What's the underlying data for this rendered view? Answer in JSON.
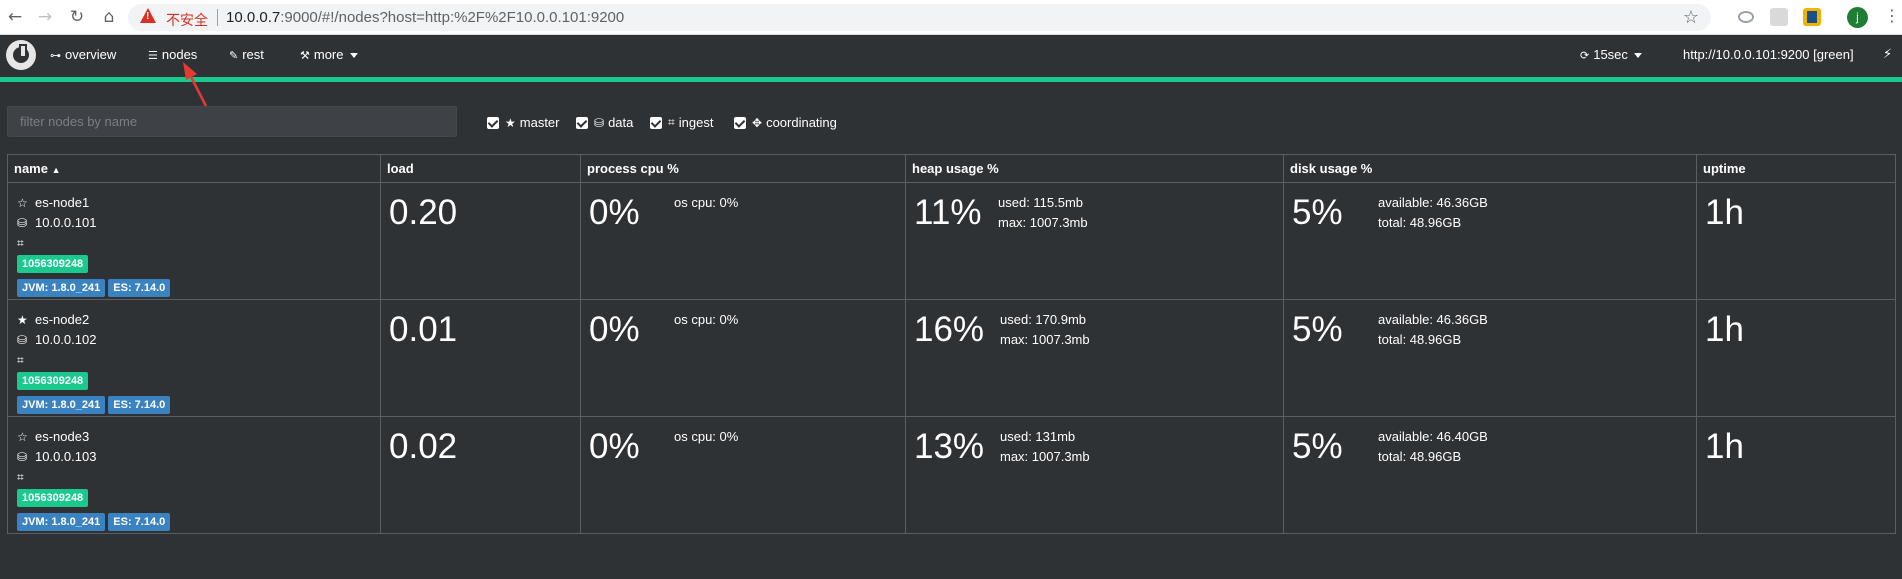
{
  "browser": {
    "insecure_label": "不安全",
    "url_host": "10.0.0.7",
    "url_rest": ":9000/#!/nodes?host=http:%2F%2F10.0.0.101:9200",
    "avatar_letter": "j",
    "back_icon": "arrow-left-icon",
    "forward_icon": "arrow-right-icon",
    "reload_icon": "reload-icon",
    "home_icon": "home-icon",
    "bookmark_icon": "star-outline-icon"
  },
  "nav": {
    "overview": "overview",
    "nodes": "nodes",
    "rest": "rest",
    "more": "more",
    "refresh": "15sec",
    "cluster": "http://10.0.0.101:9200 [green]"
  },
  "filter": {
    "placeholder": "filter nodes by name",
    "roles": [
      {
        "label": "master",
        "icon": "star-icon",
        "checked": true
      },
      {
        "label": "data",
        "icon": "hdd-icon",
        "checked": true
      },
      {
        "label": "ingest",
        "icon": "crop-icon",
        "checked": true
      },
      {
        "label": "coordinating",
        "icon": "crosshair-icon",
        "checked": true
      }
    ]
  },
  "table": {
    "headers": {
      "name": "name",
      "load": "load",
      "cpu": "process cpu %",
      "heap": "heap usage %",
      "disk": "disk usage %",
      "uptime": "uptime"
    },
    "rows": [
      {
        "name": "es-node1",
        "ip": "10.0.0.101",
        "id": "1056309248",
        "jvm": "JVM: 1.8.0_241",
        "es": "ES: 7.14.0",
        "load": "0.20",
        "cpu": "0%",
        "os_cpu": "os cpu: 0%",
        "heap": "11%",
        "heap_used": "used: 115.5mb",
        "heap_max": "max: 1007.3mb",
        "disk": "5%",
        "disk_avail": "available: 46.36GB",
        "disk_total": "total: 48.96GB",
        "uptime": "1h"
      },
      {
        "name": "es-node2",
        "ip": "10.0.0.102",
        "id": "1056309248",
        "jvm": "JVM: 1.8.0_241",
        "es": "ES: 7.14.0",
        "load": "0.01",
        "cpu": "0%",
        "os_cpu": "os cpu: 0%",
        "heap": "16%",
        "heap_used": "used: 170.9mb",
        "heap_max": "max: 1007.3mb",
        "disk": "5%",
        "disk_avail": "available: 46.36GB",
        "disk_total": "total: 48.96GB",
        "uptime": "1h"
      },
      {
        "name": "es-node3",
        "ip": "10.0.0.103",
        "id": "1056309248",
        "jvm": "JVM: 1.8.0_241",
        "es": "ES: 7.14.0",
        "load": "0.02",
        "cpu": "0%",
        "os_cpu": "os cpu: 0%",
        "heap": "13%",
        "heap_used": "used: 131mb",
        "heap_max": "max: 1007.3mb",
        "disk": "5%",
        "disk_avail": "available: 46.40GB",
        "disk_total": "total: 48.96GB",
        "uptime": "1h"
      }
    ]
  }
}
